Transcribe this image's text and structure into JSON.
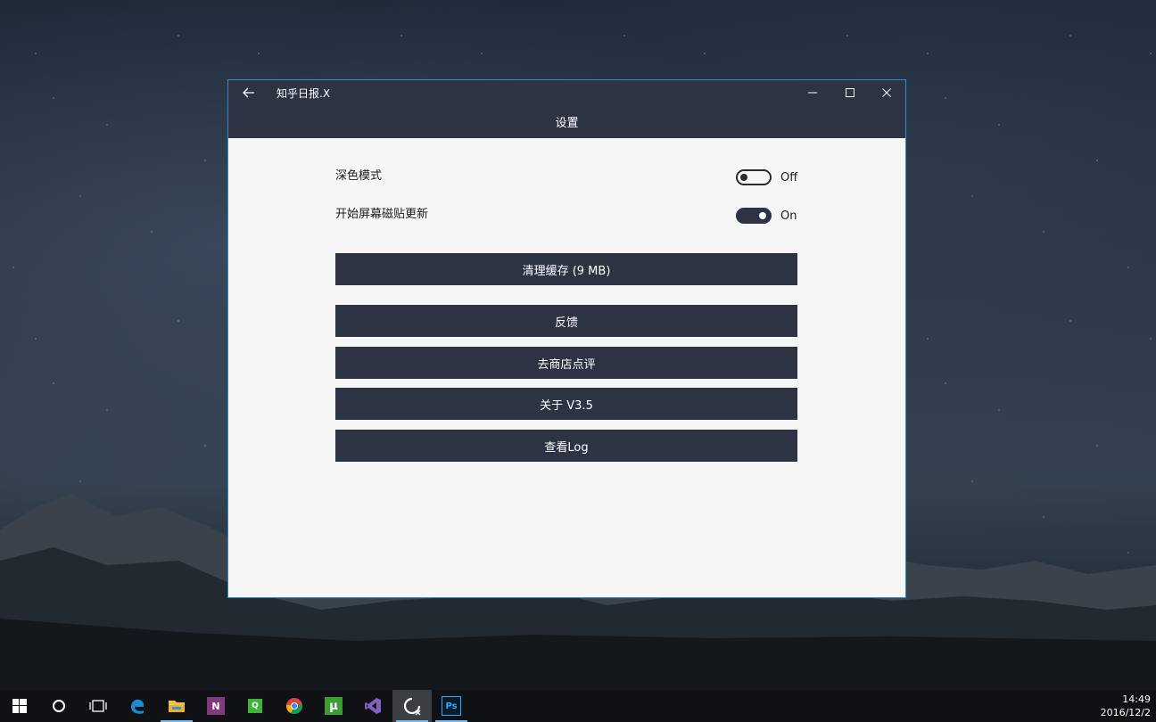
{
  "window": {
    "title": "知乎日报.X",
    "page_title": "设置"
  },
  "settings": {
    "dark_mode": {
      "label": "深色模式",
      "state": "Off",
      "on": false
    },
    "live_tile": {
      "label": "开始屏幕磁贴更新",
      "state": "On",
      "on": true
    }
  },
  "buttons": {
    "clear_cache": "清理缓存 (9 MB)",
    "feedback": "反馈",
    "rate": "去商店点评",
    "about": "关于 V3.5",
    "view_log": "查看Log"
  },
  "taskbar": {
    "time": "14:49",
    "date": "2016/12/2",
    "apps": [
      {
        "icon": "windows-start-icon"
      },
      {
        "icon": "cortana-search-icon"
      },
      {
        "icon": "task-view-icon"
      },
      {
        "icon": "edge-browser-icon"
      },
      {
        "icon": "file-explorer-icon"
      },
      {
        "icon": "onenote-icon"
      },
      {
        "icon": "qq-app-icon"
      },
      {
        "icon": "chrome-icon"
      },
      {
        "icon": "utorrent-icon"
      },
      {
        "icon": "visual-studio-icon"
      },
      {
        "icon": "zhihu-daily-app-icon"
      },
      {
        "icon": "photoshop-icon"
      }
    ]
  },
  "colors": {
    "titlebar": "#2d3343",
    "window_border": "#2f89d6",
    "content_bg": "#f6f6f6",
    "button_bg": "#2d3343"
  }
}
